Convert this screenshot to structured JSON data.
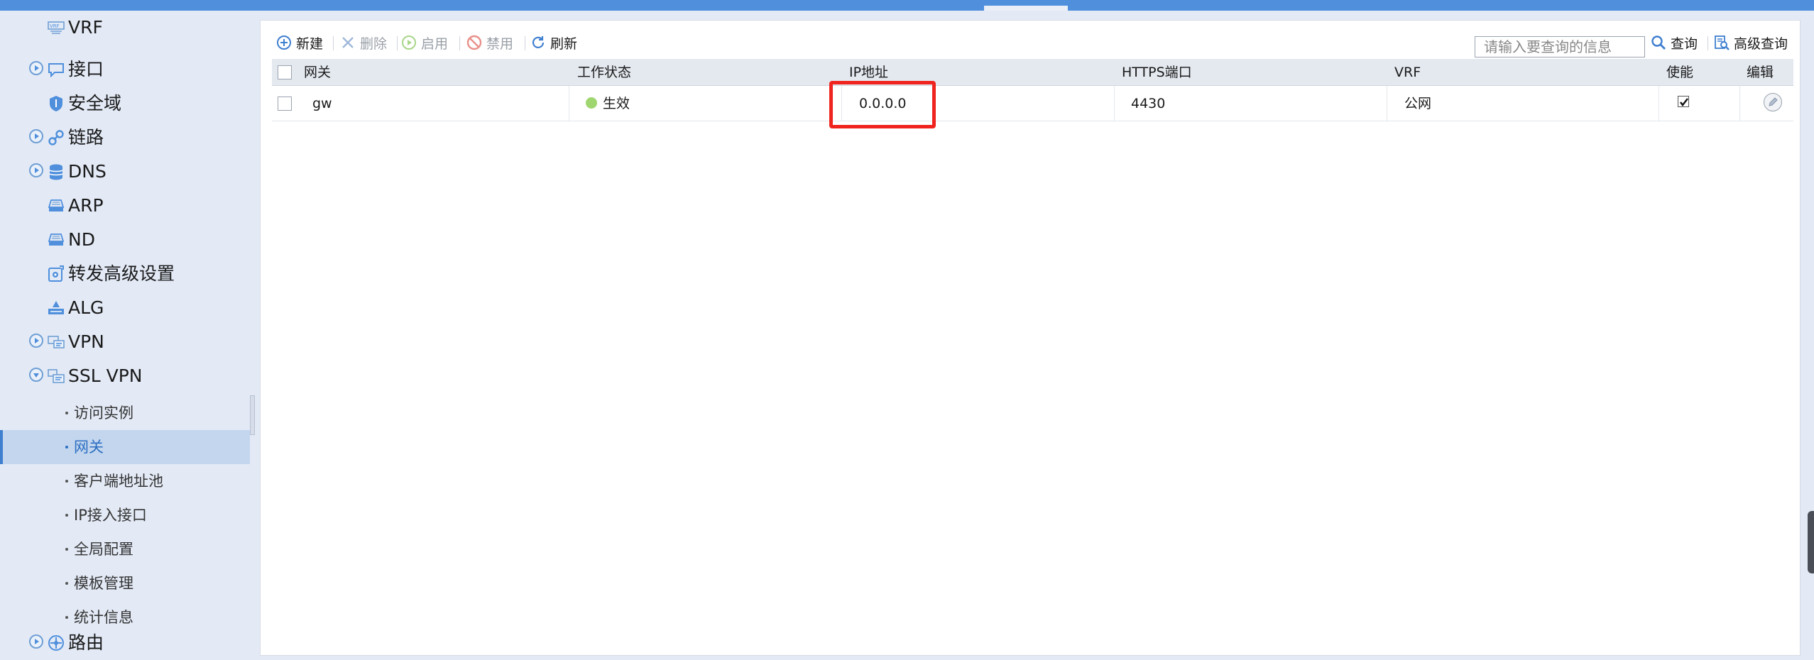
{
  "sidebar": {
    "items": [
      {
        "label": "VRF",
        "icon": "vrf-icon",
        "expandable": false
      },
      {
        "label": "接口",
        "icon": "interface-icon",
        "expandable": true
      },
      {
        "label": "安全域",
        "icon": "security-zone-icon",
        "expandable": false
      },
      {
        "label": "链路",
        "icon": "link-icon",
        "expandable": true
      },
      {
        "label": "DNS",
        "icon": "dns-icon",
        "expandable": true
      },
      {
        "label": "ARP",
        "icon": "arp-icon",
        "expandable": false
      },
      {
        "label": "ND",
        "icon": "nd-icon",
        "expandable": false
      },
      {
        "label": "转发高级设置",
        "icon": "forwarding-settings-icon",
        "expandable": false
      },
      {
        "label": "ALG",
        "icon": "alg-icon",
        "expandable": false
      },
      {
        "label": "VPN",
        "icon": "vpn-icon",
        "expandable": true
      },
      {
        "label": "SSL VPN",
        "icon": "ssl-vpn-icon",
        "expandable": true,
        "expanded": true
      }
    ],
    "ssl_vpn_children": [
      {
        "label": "访问实例"
      },
      {
        "label": "网关",
        "active": true
      },
      {
        "label": "客户端地址池"
      },
      {
        "label": "IP接入接口"
      },
      {
        "label": "全局配置"
      },
      {
        "label": "模板管理"
      },
      {
        "label": "统计信息"
      }
    ],
    "routing": {
      "label": "路由",
      "icon": "routing-icon"
    }
  },
  "toolbar": {
    "new_label": "新建",
    "delete_label": "删除",
    "enable_label": "启用",
    "disable_label": "禁用",
    "refresh_label": "刷新",
    "search_placeholder": "请输入要查询的信息",
    "query_label": "查询",
    "advanced_query_label": "高级查询"
  },
  "table": {
    "columns": [
      "网关",
      "工作状态",
      "IP地址",
      "HTTPS端口",
      "VRF",
      "使能",
      "编辑"
    ],
    "rows": [
      {
        "gateway": "gw",
        "status": "生效",
        "ip": "0.0.0.0",
        "https_port": "4430",
        "vrf": "公网",
        "enabled": true
      }
    ]
  },
  "colors": {
    "accent": "#4f8fdc",
    "highlight": "#f0241e",
    "status_active": "#9fd66f"
  }
}
